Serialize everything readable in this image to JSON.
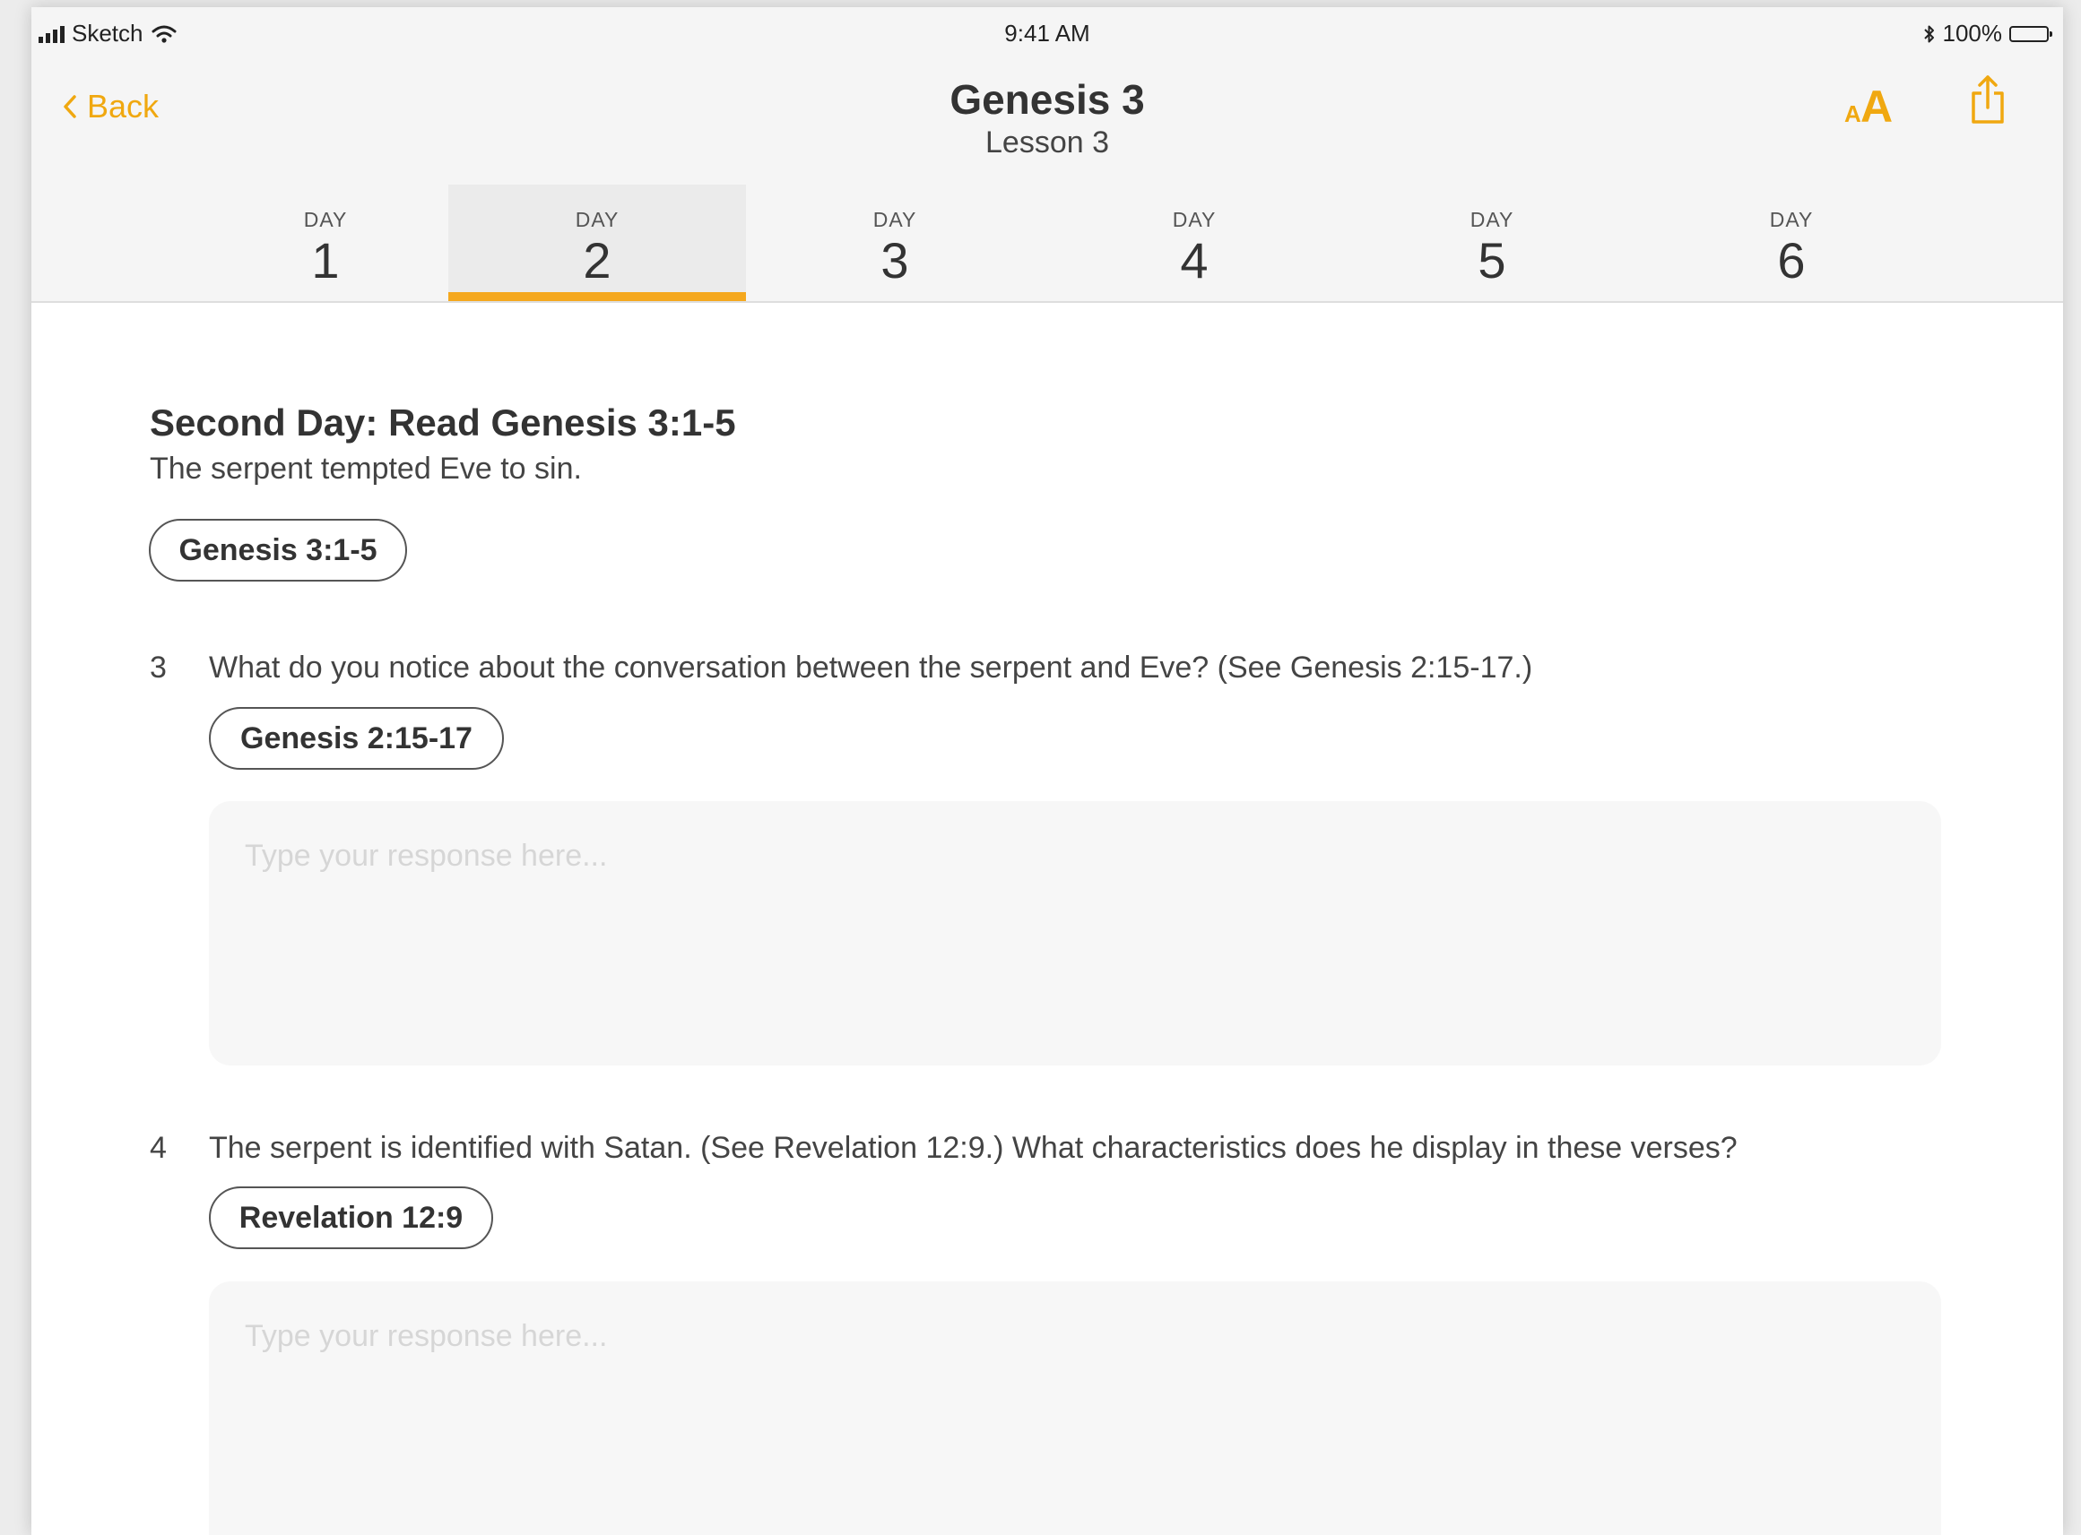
{
  "status_bar": {
    "carrier": "Sketch",
    "time": "9:41 AM",
    "battery": "100%"
  },
  "nav": {
    "back_label": "Back",
    "title": "Genesis 3",
    "subtitle": "Lesson 3"
  },
  "tabs": [
    {
      "label": "DAY",
      "number": "1"
    },
    {
      "label": "DAY",
      "number": "2",
      "active": true
    },
    {
      "label": "DAY",
      "number": "3"
    },
    {
      "label": "DAY",
      "number": "4"
    },
    {
      "label": "DAY",
      "number": "5"
    },
    {
      "label": "DAY",
      "number": "6"
    }
  ],
  "section": {
    "title": "Second Day: Read Genesis 3:1-5",
    "subtitle": "The serpent tempted Eve to sin.",
    "reference": "Genesis 3:1-5"
  },
  "questions": [
    {
      "number": "3",
      "text": "What do you notice about the conversation between the serpent and Eve? (See Genesis 2:15-17.)",
      "reference": "Genesis 2:15-17",
      "response_value": "",
      "response_placeholder": "Type your response here..."
    },
    {
      "number": "4",
      "text": "The serpent is identified with Satan. (See Revelation 12:9.) What characteristics does he display in these verses?",
      "reference": "Revelation 12:9",
      "response_value": "",
      "response_placeholder": "Type your response here..."
    }
  ],
  "icons": {
    "back": "chevron-left-icon",
    "font_size": "font-size-icon",
    "share": "share-icon",
    "signal": "signal-icon",
    "wifi": "wifi-icon",
    "bluetooth": "bluetooth-icon",
    "battery": "battery-icon"
  },
  "colors": {
    "accent": "#f0a810",
    "tab_indicator": "#f5a81e",
    "header_bg": "#f5f5f5",
    "response_bg": "#f7f7f7"
  }
}
